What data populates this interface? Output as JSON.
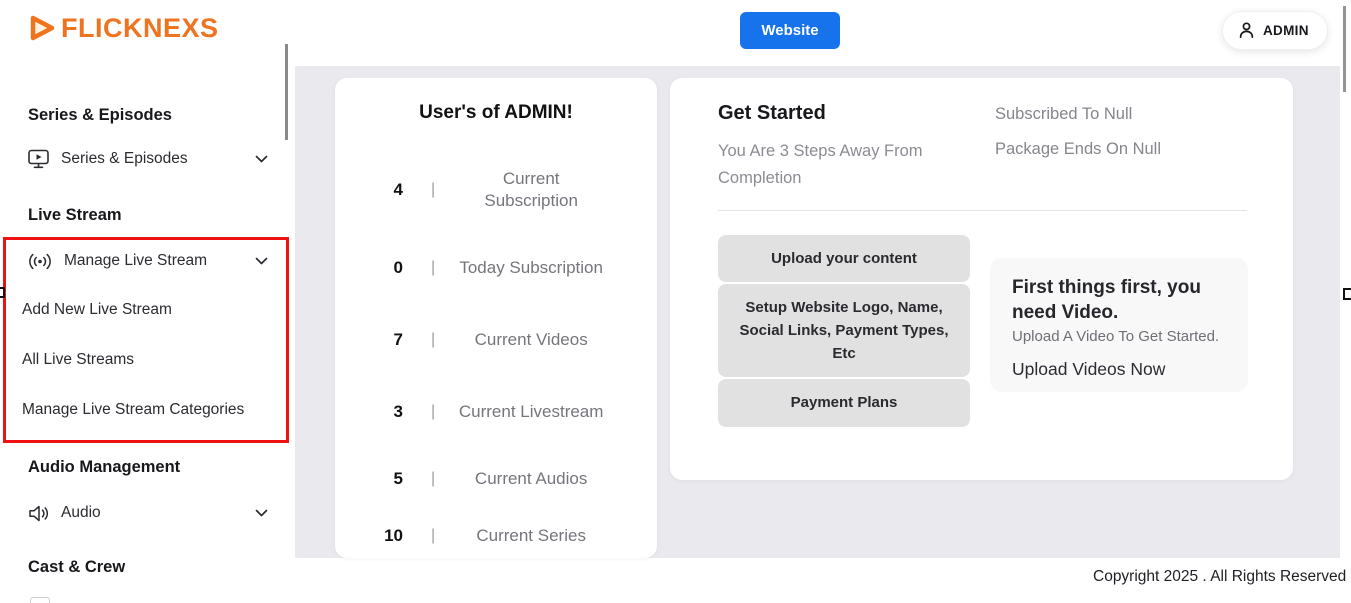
{
  "brand": {
    "logo_text": "FLICKNEXS",
    "color": "#ef7420"
  },
  "header": {
    "website_button": "Website",
    "admin_button": "ADMIN"
  },
  "sidebar": {
    "groups": [
      {
        "heading": "Series & Episodes",
        "item": "Series & Episodes"
      },
      {
        "heading": "Live Stream",
        "item": "Manage Live Stream",
        "subitems": [
          "Add New Live Stream",
          "All Live Streams",
          "Manage Live Stream Categories"
        ],
        "highlight_color": "#ef1111"
      },
      {
        "heading": "Audio Management",
        "item": "Audio"
      },
      {
        "heading": "Cast & Crew"
      }
    ]
  },
  "stats": {
    "title": "User's of ADMIN!",
    "rows": [
      {
        "value": "4",
        "separator": "|",
        "label": "Current Subscription"
      },
      {
        "value": "0",
        "separator": "|",
        "label": "Today Subscription"
      },
      {
        "value": "7",
        "separator": "|",
        "label": "Current Videos"
      },
      {
        "value": "3",
        "separator": "|",
        "label": "Current Livestream"
      },
      {
        "value": "5",
        "separator": "|",
        "label": "Current Audios"
      },
      {
        "value": "10",
        "separator": "|",
        "label": "Current Series"
      }
    ]
  },
  "get_started": {
    "title": "Get Started",
    "subtitle": "You Are 3 Steps Away From Completion",
    "subscribed_to": "Subscribed To Null",
    "package_ends": "Package Ends On Null",
    "steps": [
      "Upload your content",
      "Setup Website Logo, Name, Social Links, Payment Types, Etc",
      "Payment Plans"
    ],
    "promo": {
      "title": "First things first, you need Video.",
      "subtitle": "Upload A Video To Get Started.",
      "link": "Upload Videos Now"
    }
  },
  "footer": {
    "copyright": "Copyright 2025 . All Rights Reserved"
  },
  "colors": {
    "accent_blue": "#1673ec",
    "brand_orange": "#ef7420",
    "annotation_red": "#ef1111",
    "content_bg": "#e9e9ee"
  }
}
